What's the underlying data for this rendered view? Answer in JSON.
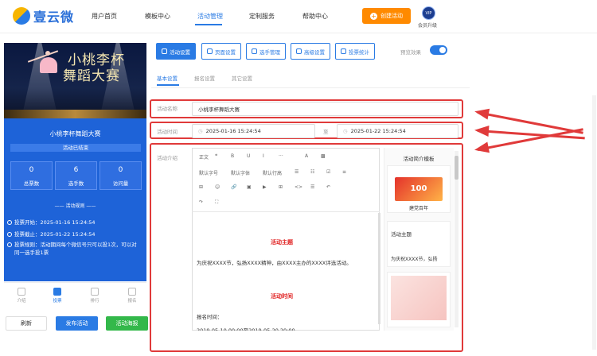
{
  "brand": {
    "name": "壹云微"
  },
  "nav": {
    "items": [
      "用户首页",
      "模板中心",
      "活动管理",
      "定制服务",
      "帮助中心"
    ],
    "active_index": 2,
    "create_label": "创建活动",
    "vip_badge": "VIP",
    "vip_label": "会员升级"
  },
  "preview": {
    "banner_title": "小桃李杯\n舞蹈大赛",
    "activity_title": "小桃李杯舞蹈大赛",
    "status": "活动已结束",
    "stats": [
      {
        "value": "0",
        "label": "总票数"
      },
      {
        "value": "6",
        "label": "选手数"
      },
      {
        "value": "0",
        "label": "访问量"
      }
    ],
    "rules_title": "—— 活动规则 ——",
    "rules": [
      "投票开始：2025-01-16 15:24:54",
      "投票截止：2025-01-22 15:24:54",
      "投票规则：活动期间每个微信号只可以投1次，可以对同一选手投1票"
    ],
    "tabs": [
      "介绍",
      "投票",
      "排行",
      "报名"
    ],
    "active_tab": 1
  },
  "bottom_buttons": {
    "refresh": "刷新",
    "publish": "发布活动",
    "poster": "活动海报"
  },
  "toolbar": {
    "buttons": [
      "活动设置",
      "页面设置",
      "选手管理",
      "高级设置",
      "投票统计"
    ],
    "active_index": 0,
    "preview_label": "预览效果",
    "preview_on": true
  },
  "subtabs": {
    "items": [
      "基本设置",
      "报名设置",
      "其它设置"
    ],
    "active_index": 0
  },
  "form": {
    "name_label": "活动名称",
    "name_value": "小桃李杯舞蹈大赛",
    "time_label": "活动时间",
    "start_time": "2025-01-16 15:24:54",
    "time_sep": "至",
    "end_time": "2025-01-22 15:24:54",
    "intro_label": "活动介绍"
  },
  "editor": {
    "toolbar_row1": [
      "正文",
      "❝",
      "B",
      "U",
      "I",
      "···",
      "A",
      "▩"
    ],
    "toolbar_row2": [
      "默认字号",
      "默认字体",
      "默认行高",
      "☰",
      "☷",
      "☑",
      "≡"
    ],
    "toolbar_row3": [
      "⊞",
      "☺",
      "🔗",
      "▣",
      "▶",
      "⊞",
      "<>",
      "☰",
      "↶"
    ],
    "toolbar_row4": [
      "↷",
      "⛶"
    ],
    "content": {
      "heading1": "活动主题",
      "para1": "为庆祝XXXX节，弘扬XXXX精神，由XXXX主办的XXXX评选活动。",
      "heading2": "活动时间",
      "label": "报名时间：",
      "date_line": "2019-05-10 00:00至2019-05-20 20:00"
    }
  },
  "templates": {
    "title": "活动简介模板",
    "card1_text": "建党百年",
    "card2_title": "活动主题",
    "card2_text": "为庆祝XXXX节，弘扬"
  },
  "colors": {
    "primary": "#2a7be4",
    "orange": "#ff8a00",
    "green": "#33b84a",
    "annotation_red": "#e03a3a"
  }
}
